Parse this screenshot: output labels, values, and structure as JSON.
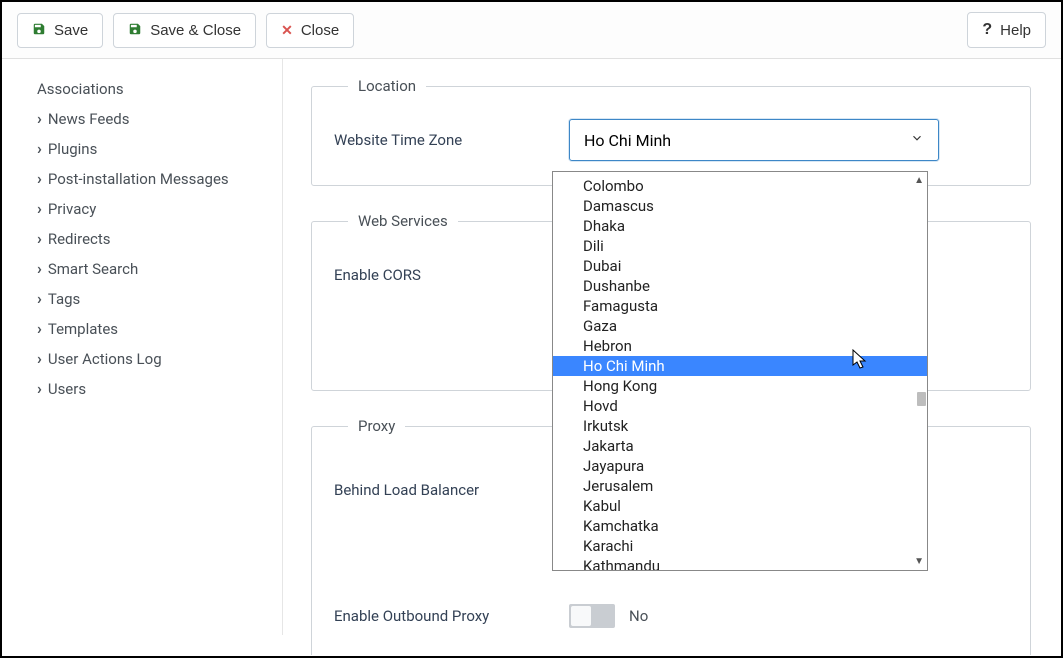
{
  "toolbar": {
    "save": "Save",
    "save_close": "Save & Close",
    "close": "Close",
    "help": "Help"
  },
  "sidebar": {
    "items": [
      {
        "label": "Associations",
        "icon": false
      },
      {
        "label": "News Feeds",
        "icon": true
      },
      {
        "label": "Plugins",
        "icon": true
      },
      {
        "label": "Post-installation Messages",
        "icon": true
      },
      {
        "label": "Privacy",
        "icon": true
      },
      {
        "label": "Redirects",
        "icon": true
      },
      {
        "label": "Smart Search",
        "icon": true
      },
      {
        "label": "Tags",
        "icon": true
      },
      {
        "label": "Templates",
        "icon": true
      },
      {
        "label": "User Actions Log",
        "icon": true
      },
      {
        "label": "Users",
        "icon": true
      }
    ]
  },
  "fieldsets": {
    "location": {
      "legend": "Location",
      "tz_label": "Website Time Zone",
      "tz_value": "Ho Chi Minh"
    },
    "web": {
      "legend": "Web Services",
      "cors_label": "Enable CORS"
    },
    "proxy": {
      "legend": "Proxy",
      "blb_label": "Behind Load Balancer",
      "eop_label": "Enable Outbound Proxy",
      "eop_value": "No"
    }
  },
  "dropdown": {
    "options": [
      "Colombo",
      "Damascus",
      "Dhaka",
      "Dili",
      "Dubai",
      "Dushanbe",
      "Famagusta",
      "Gaza",
      "Hebron",
      "Ho Chi Minh",
      "Hong Kong",
      "Hovd",
      "Irkutsk",
      "Jakarta",
      "Jayapura",
      "Jerusalem",
      "Kabul",
      "Kamchatka",
      "Karachi",
      "Kathmandu"
    ],
    "selected": "Ho Chi Minh"
  }
}
